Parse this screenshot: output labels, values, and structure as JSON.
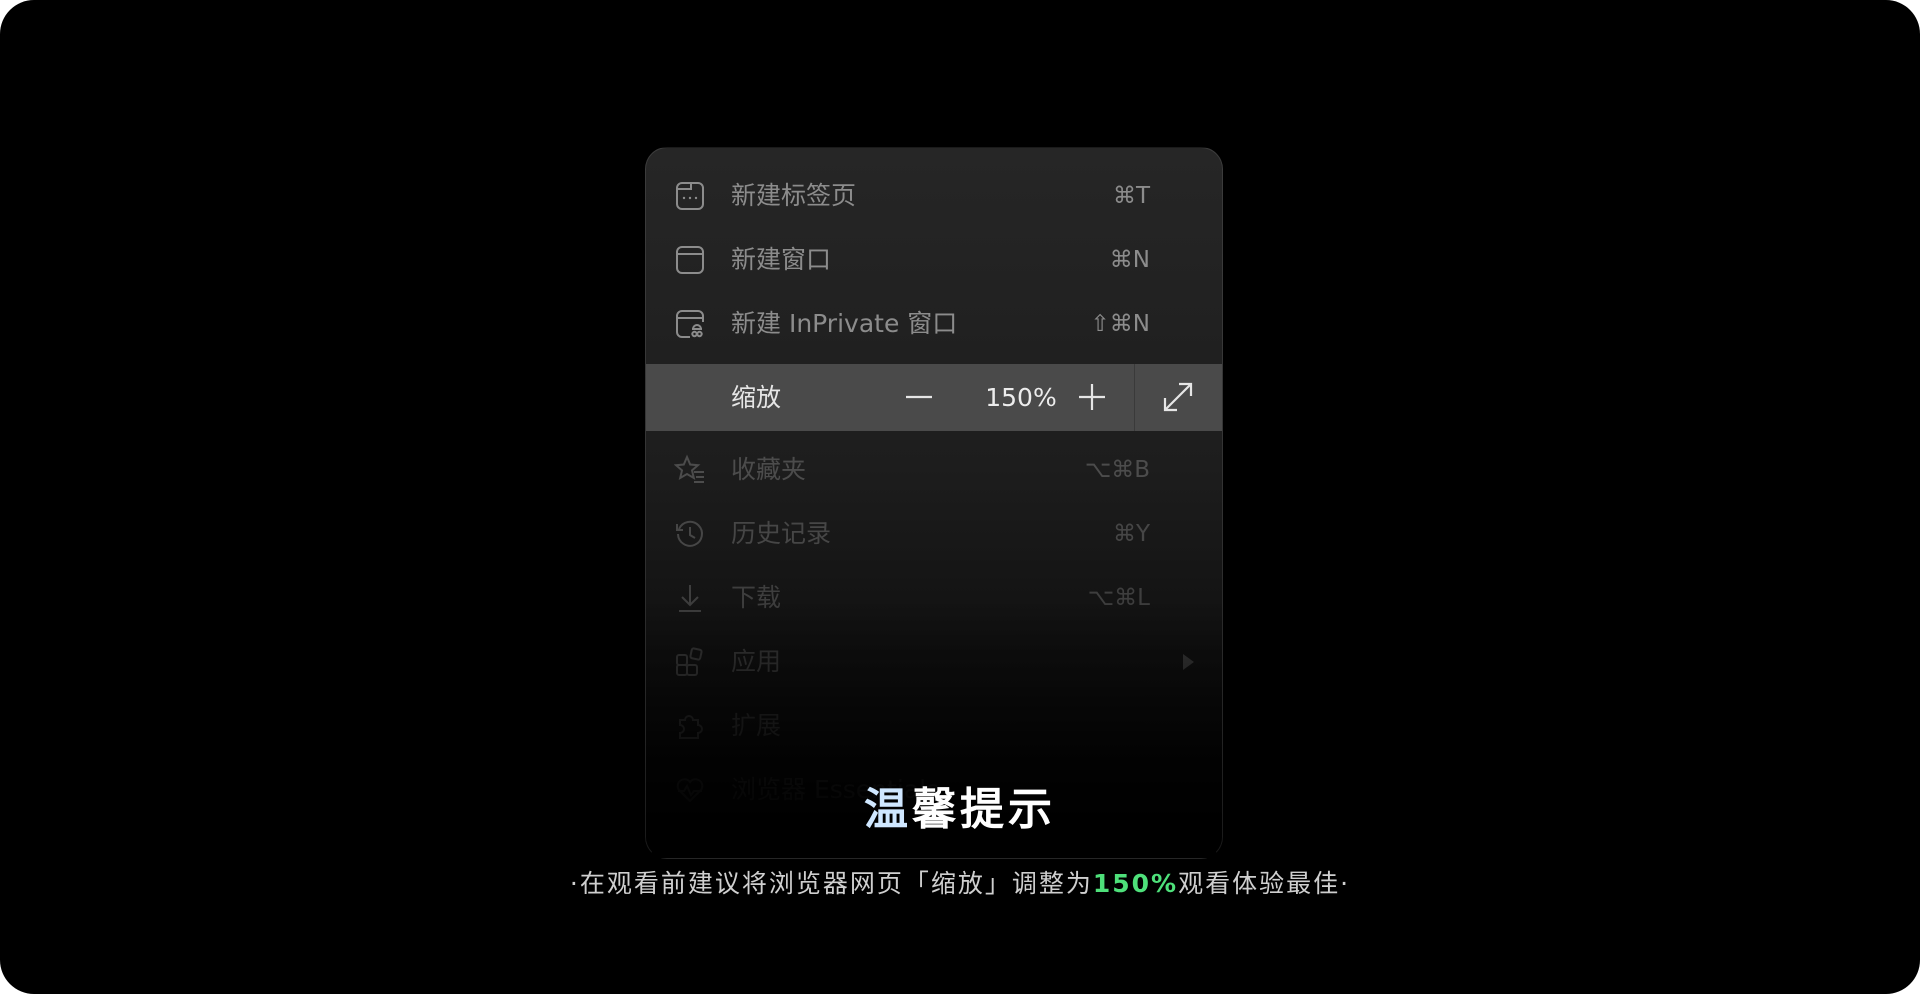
{
  "colors": {
    "page_background": "#000000",
    "menu_background": "#222222",
    "zoom_row_background": "#4a4a4a",
    "accent_green": "#4ee07a",
    "title_accent": "#cfe7ff"
  },
  "menu": {
    "items": [
      {
        "label": "新建标签页",
        "shortcut": "⌘T",
        "icon": "new-tab-icon"
      },
      {
        "label": "新建窗口",
        "shortcut": "⌘N",
        "icon": "new-window-icon"
      },
      {
        "label": "新建 InPrivate 窗口",
        "shortcut": "⇧⌘N",
        "icon": "inprivate-window-icon"
      }
    ],
    "zoom": {
      "label": "缩放",
      "value": "150%",
      "minus_icon": "minus-icon",
      "plus_icon": "plus-icon",
      "fullscreen_icon": "fullscreen-icon"
    },
    "lower_items": [
      {
        "label": "收藏夹",
        "shortcut": "⌥⌘B",
        "icon": "favorites-icon"
      },
      {
        "label": "历史记录",
        "shortcut": "⌘Y",
        "icon": "history-icon"
      },
      {
        "label": "下载",
        "shortcut": "⌥⌘L",
        "icon": "download-icon"
      },
      {
        "label": "应用",
        "shortcut": "",
        "icon": "apps-icon"
      },
      {
        "label": "扩展",
        "shortcut": "",
        "icon": "extensions-icon"
      },
      {
        "label": "浏览器 Essentials",
        "shortcut": "",
        "icon": "essentials-icon"
      }
    ]
  },
  "tip": {
    "title_first": "温",
    "title_rest": "馨提示",
    "text_before": "·在观看前建议将浏览器网页「缩放」调整为",
    "highlight": "150%",
    "text_after": "观看体验最佳·"
  }
}
